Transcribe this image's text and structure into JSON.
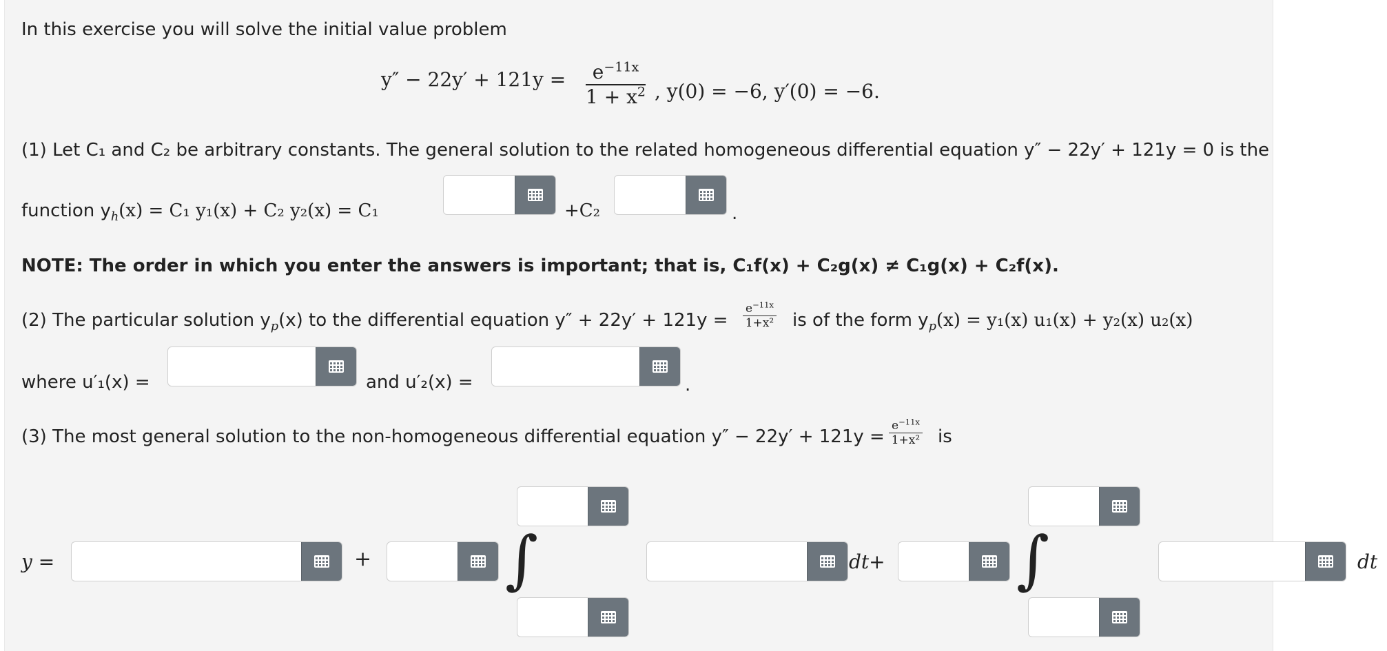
{
  "intro": "In this exercise you will solve the initial value problem",
  "ivp": {
    "lhs": "y″ − 22y′ + 121y =",
    "num": "e",
    "num_exp": "−11x",
    "den": "1 + x",
    "den_exp": "2",
    "conds": ", y(0) = −6, y′(0) = −6."
  },
  "part1": {
    "line1": "(1) Let C₁ and C₂ be arbitrary constants. The general solution to the related homogeneous differential equation y″ − 22y′ + 121y = 0 is the",
    "function_prefix": "function y",
    "function_sub": "h",
    "function_rest": "(x) = C₁ y₁(x) + C₂ y₂(x) = C₁",
    "plus_c2": "+C₂",
    "period": "."
  },
  "note": "NOTE: The order in which you enter the answers is important; that is, C₁f(x) + C₂g(x) ≠ C₁g(x) + C₂f(x).",
  "part2": {
    "prefix": "(2) The particular solution y",
    "prefix_sub": "p",
    "prefix_rest": "(x) to the differential equation y″ + 22y′ + 121y =",
    "frac_num": "e",
    "frac_num_exp": "−11x",
    "frac_den": "1+x²",
    "suffix": "is of the form y",
    "suffix_sub": "p",
    "suffix_rest": "(x) = y₁(x) u₁(x) + y₂(x) u₂(x)",
    "where": "where u′₁(x) =",
    "and": "and u′₂(x) =",
    "period": "."
  },
  "part3": {
    "text": "(3) The most general solution to the non-homogeneous differential equation y″ − 22y′ + 121y =",
    "frac_num": "e",
    "frac_num_exp": "−11x",
    "frac_den": "1+x²",
    "is": "is",
    "y_eq": "y =",
    "plus": "+",
    "integral": "∫",
    "dtplus": "dt+",
    "dt": "dt"
  },
  "icons": {
    "answer_button": "grid-icon"
  },
  "colors": {
    "button": "#6c757d",
    "panel": "#f4f4f4"
  }
}
